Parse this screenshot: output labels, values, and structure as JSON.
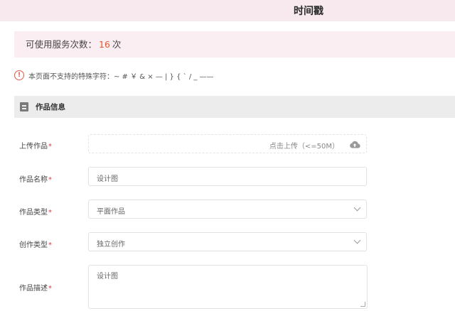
{
  "header": {
    "title": "时间戳"
  },
  "service": {
    "label": "可使用服务次数：",
    "count": "16",
    "unit": "次"
  },
  "notice": {
    "icon": "info-icon",
    "text": "本页面不支持的特殊字符：~ # ￥ & × — | } { ` / _ ——"
  },
  "section": {
    "icon": "document-icon",
    "title": "作品信息"
  },
  "form": {
    "required_mark": "*",
    "upload": {
      "label": "上传作品",
      "hint": "点击上传（<=50M）",
      "icon": "cloud-upload-icon"
    },
    "name": {
      "label": "作品名称",
      "value": "设计图"
    },
    "type": {
      "label": "作品类型",
      "value": "平面作品"
    },
    "creation_type": {
      "label": "创作类型",
      "value": "独立创作"
    },
    "description": {
      "label": "作品描述",
      "value": "设计图"
    }
  }
}
